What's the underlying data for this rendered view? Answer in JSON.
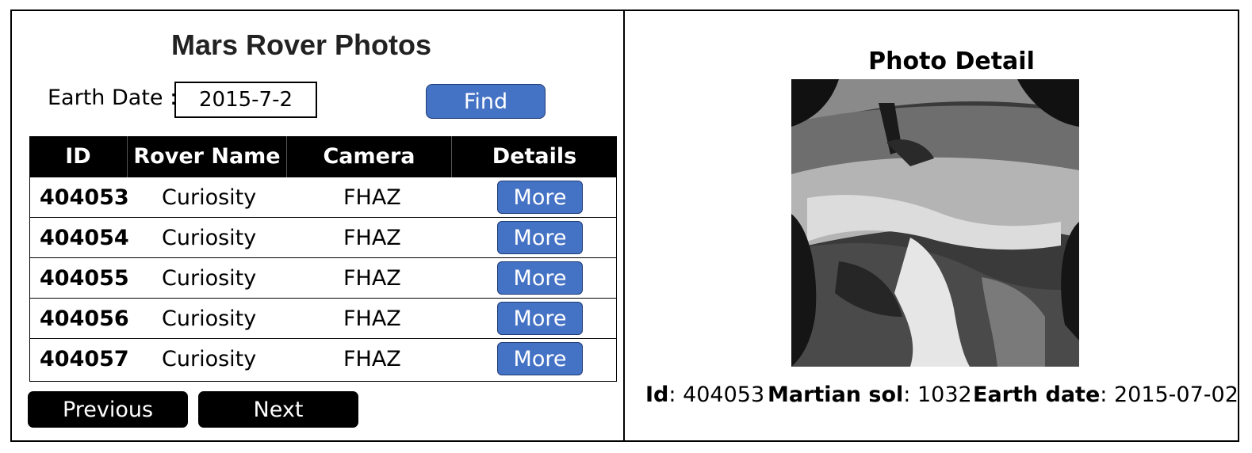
{
  "app": {
    "title": "Mars Rover Photos"
  },
  "search": {
    "label": "Earth Date :",
    "value": "2015-7-2",
    "button": "Find"
  },
  "table": {
    "headers": [
      "ID",
      "Rover Name",
      "Camera",
      "Details"
    ],
    "rows": [
      {
        "id": "404053",
        "rover": "Curiosity",
        "camera": "FHAZ",
        "action": "More"
      },
      {
        "id": "404054",
        "rover": "Curiosity",
        "camera": "FHAZ",
        "action": "More"
      },
      {
        "id": "404055",
        "rover": "Curiosity",
        "camera": "FHAZ",
        "action": "More"
      },
      {
        "id": "404056",
        "rover": "Curiosity",
        "camera": "FHAZ",
        "action": "More"
      },
      {
        "id": "404057",
        "rover": "Curiosity",
        "camera": "FHAZ",
        "action": "More"
      }
    ]
  },
  "pagination": {
    "previous": "Previous",
    "next": "Next"
  },
  "detail": {
    "title": "Photo Detail",
    "id_label": "Id",
    "id_value": "404053",
    "sol_label": "Martian sol",
    "sol_value": "1032",
    "earth_label": "Earth date",
    "earth_value": "2015-07-02"
  },
  "colors": {
    "accent": "#4472c4",
    "header_bg": "#000000"
  }
}
